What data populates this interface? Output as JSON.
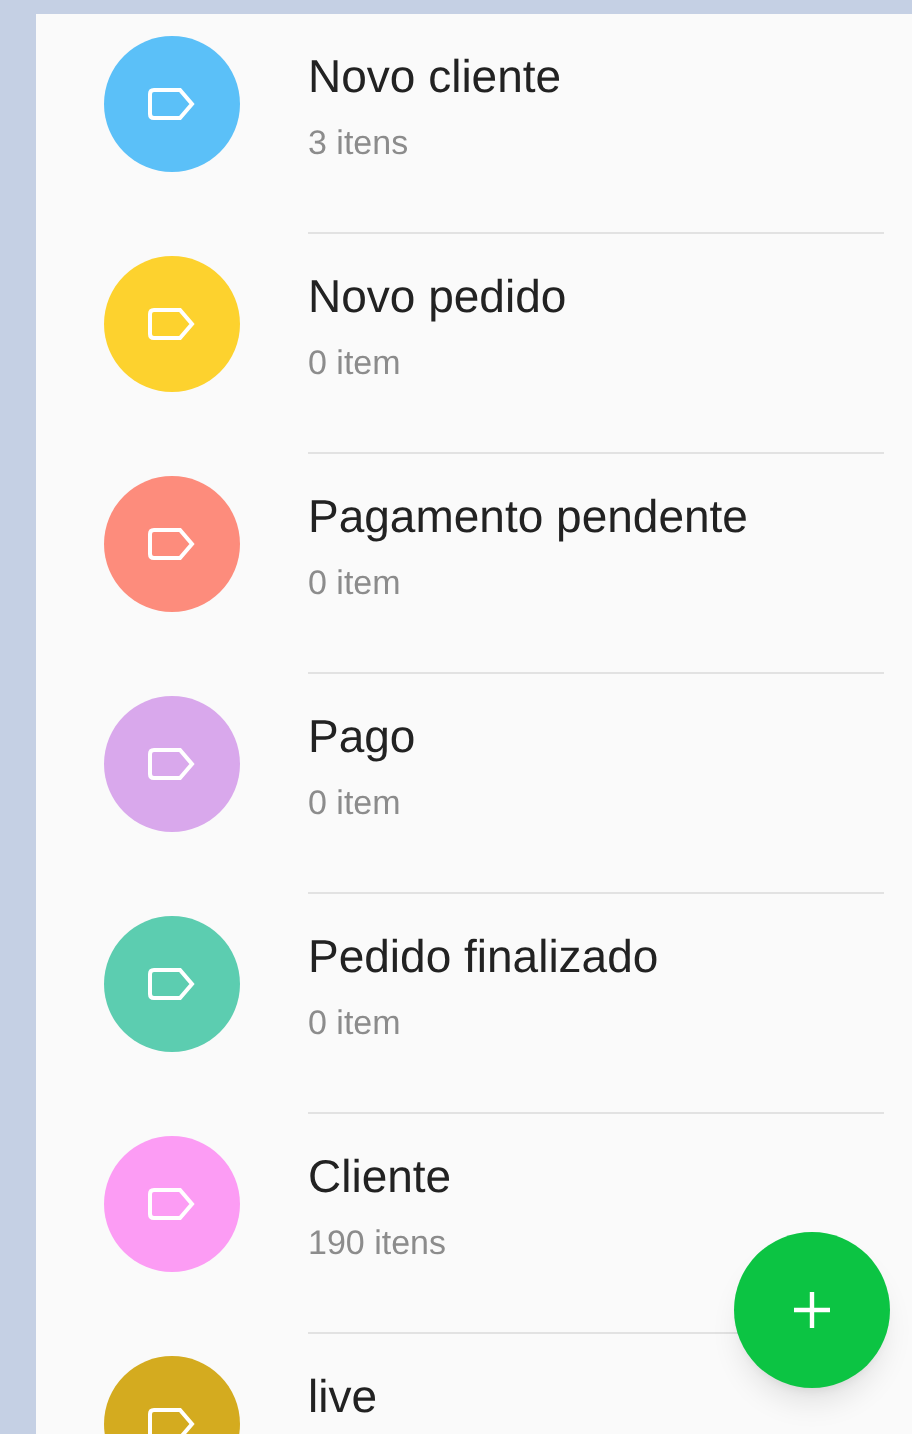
{
  "labels": [
    {
      "name": "Novo cliente",
      "count": "3 itens",
      "color": "#5bc0f8"
    },
    {
      "name": "Novo pedido",
      "count": "0 item",
      "color": "#fdd22e"
    },
    {
      "name": "Pagamento pendente",
      "count": "0 item",
      "color": "#fd8c7c"
    },
    {
      "name": "Pago",
      "count": "0 item",
      "color": "#d9a8ec"
    },
    {
      "name": "Pedido finalizado",
      "count": "0 item",
      "color": "#5ccdb0"
    },
    {
      "name": "Cliente",
      "count": "190 itens",
      "color": "#fc9cf4"
    },
    {
      "name": "live",
      "color": "#d4ab1f"
    }
  ]
}
